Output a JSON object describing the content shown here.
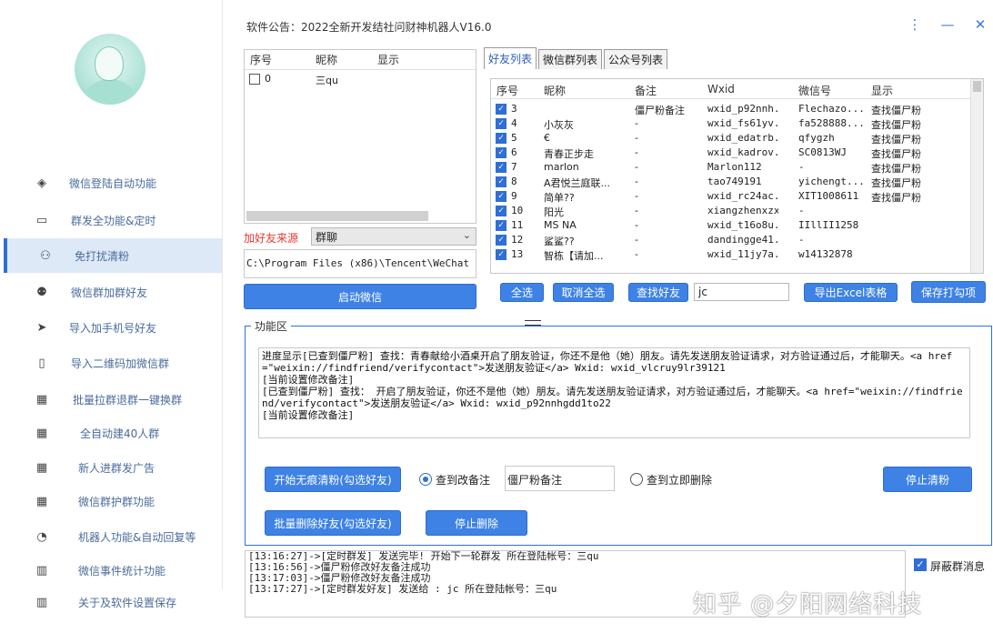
{
  "title_bar": {
    "notice": "软件公告：2022全新开发结社问财神机器人V16.0",
    "more_icon": "more-vertical-icon",
    "minimize_icon": "minimize-icon",
    "close_icon": "close-icon"
  },
  "sidebar": {
    "items": [
      {
        "label": "微信登陆自动功能",
        "icon": "layers-icon",
        "glyph": "◈"
      },
      {
        "label": "群发全功能&定时",
        "icon": "folder-icon",
        "glyph": "▭"
      },
      {
        "label": "免打扰清粉",
        "icon": "user-icon",
        "glyph": "⚇"
      },
      {
        "label": "微信群加群好友",
        "icon": "add-user-icon",
        "glyph": "⚉"
      },
      {
        "label": "导入加手机号好友",
        "icon": "send-icon",
        "glyph": "➤"
      },
      {
        "label": "导入二维码加微信群",
        "icon": "phone-icon",
        "glyph": "▯"
      },
      {
        "label": "批量拉群退群一键换群",
        "icon": "grid-icon",
        "glyph": "▦"
      },
      {
        "label": "全自动建40人群",
        "icon": "grid-icon",
        "glyph": "▦"
      },
      {
        "label": "新人进群发广告",
        "icon": "grid-icon",
        "glyph": "▦"
      },
      {
        "label": "微信群护群功能",
        "icon": "grid-icon",
        "glyph": "▦"
      },
      {
        "label": "机器人功能&自动回复等",
        "icon": "clock-icon",
        "glyph": "◔"
      },
      {
        "label": "微信事件统计功能",
        "icon": "trash-icon",
        "glyph": "▥"
      },
      {
        "label": "关于及软件设置保存",
        "icon": "trash-icon",
        "glyph": "▥"
      }
    ]
  },
  "group_list": {
    "headers": [
      "序号",
      "昵称",
      "显示"
    ],
    "rows": [
      {
        "index": "0",
        "name": "三qu",
        "display": ""
      }
    ]
  },
  "source": {
    "label": "加好友来源",
    "selected": "群聊",
    "path": "C:\\Program Files (x86)\\Tencent\\WeChat"
  },
  "buttons": {
    "launch": "启动微信",
    "select_all": "全选",
    "deselect_all": "取消全选",
    "find_friend": "查找好友",
    "export_excel": "导出Excel表格",
    "save_print": "保存打勾项",
    "start_clean": "开始无痕清粉(勾选好友)",
    "stop_clean": "停止清粉",
    "batch_delete": "批量删除好友(勾选好友)",
    "stop_delete": "停止删除"
  },
  "tabs": [
    "好友列表",
    "微信群列表",
    "公众号列表"
  ],
  "friends": {
    "headers": [
      "序号",
      "昵称",
      "备注",
      "Wxid",
      "微信号",
      "显示"
    ],
    "rows": [
      {
        "index": "3",
        "name": "",
        "note": "僵尸粉备注",
        "wxid": "wxid_p92nnh...",
        "wechat": "Flechazo...",
        "display": "查找僵尸粉"
      },
      {
        "index": "4",
        "name": "小灰灰",
        "note": "-",
        "wxid": "wxid_fs61yv...",
        "wechat": "fa528888...",
        "display": "查找僵尸粉"
      },
      {
        "index": "5",
        "name": "€",
        "note": "-",
        "wxid": "wxid_edatrb...",
        "wechat": "qfygzh",
        "display": "查找僵尸粉"
      },
      {
        "index": "6",
        "name": "青春正步走",
        "note": "-",
        "wxid": "wxid_kadrov...",
        "wechat": "SC0813WJ",
        "display": "查找僵尸粉"
      },
      {
        "index": "7",
        "name": "marlon",
        "note": "-",
        "wxid": "Marlon112",
        "wechat": "-",
        "display": "查找僵尸粉"
      },
      {
        "index": "8",
        "name": "A君悦兰庭联...",
        "note": "-",
        "wxid": "tao749191",
        "wechat": "yichengt...",
        "display": "查找僵尸粉"
      },
      {
        "index": "9",
        "name": "简单??",
        "note": "-",
        "wxid": "wxid_rc24ac...",
        "wechat": "XIT1008611",
        "display": "查找僵尸粉"
      },
      {
        "index": "10",
        "name": "阳光",
        "note": "-",
        "wxid": "xiangzhenxzxz",
        "wechat": "-",
        "display": ""
      },
      {
        "index": "11",
        "name": "MS   NA",
        "note": "-",
        "wxid": "wxid_t16o8u...",
        "wechat": "IIllII1258",
        "display": ""
      },
      {
        "index": "12",
        "name": "鲨鲨??",
        "note": "-",
        "wxid": "dandingge41...",
        "wechat": "-",
        "display": ""
      },
      {
        "index": "13",
        "name": "智栋【请加...",
        "note": "-",
        "wxid": "wxid_11jy7a...",
        "wechat": "w14132878",
        "display": ""
      }
    ]
  },
  "search": {
    "value": "jc"
  },
  "function_area": {
    "title": "功能区",
    "log": [
      "进度显示[已查到僵尸粉] 查找：青春献给小酒桌开启了朋友验证，你还不是他（她）朋友。请先发送朋友验证请求，对方验证通过后，才能聊天。<a href=\"weixin://findfriend/verifycontact\">发送朋友验证</a> Wxid: wxid_vlcruy9lr39121",
      "[当前设置修改备注]",
      "[已查到僵尸粉] 查找： 开启了朋友验证，你还不是他（她）朋友。请先发送朋友验证请求，对方验证通过后，才能聊天。<a href=\"weixin://findfriend/verifycontact\">发送朋友验证</a> Wxid: wxid_p92nnhgdd1to22",
      "[当前设置修改备注]"
    ],
    "option_note": "查到改备注",
    "note_value": "僵尸粉备注",
    "option_delete": "查到立即删除"
  },
  "output_log": [
    "[13:16:27]->[定时群发] 发送完毕! 开始下一轮群发 所在登陆帐号：三qu",
    "[13:16:56]->僵尸粉修改好友备注成功",
    "[13:17:03]->僵尸粉修改好友备注成功",
    "[13:17:27]->[定时群发好友] 发送给 : jc 所在登陆帐号：三qu"
  ],
  "mask_group": "屏蔽群消息",
  "watermark": "知乎 @夕阳网络科技"
}
